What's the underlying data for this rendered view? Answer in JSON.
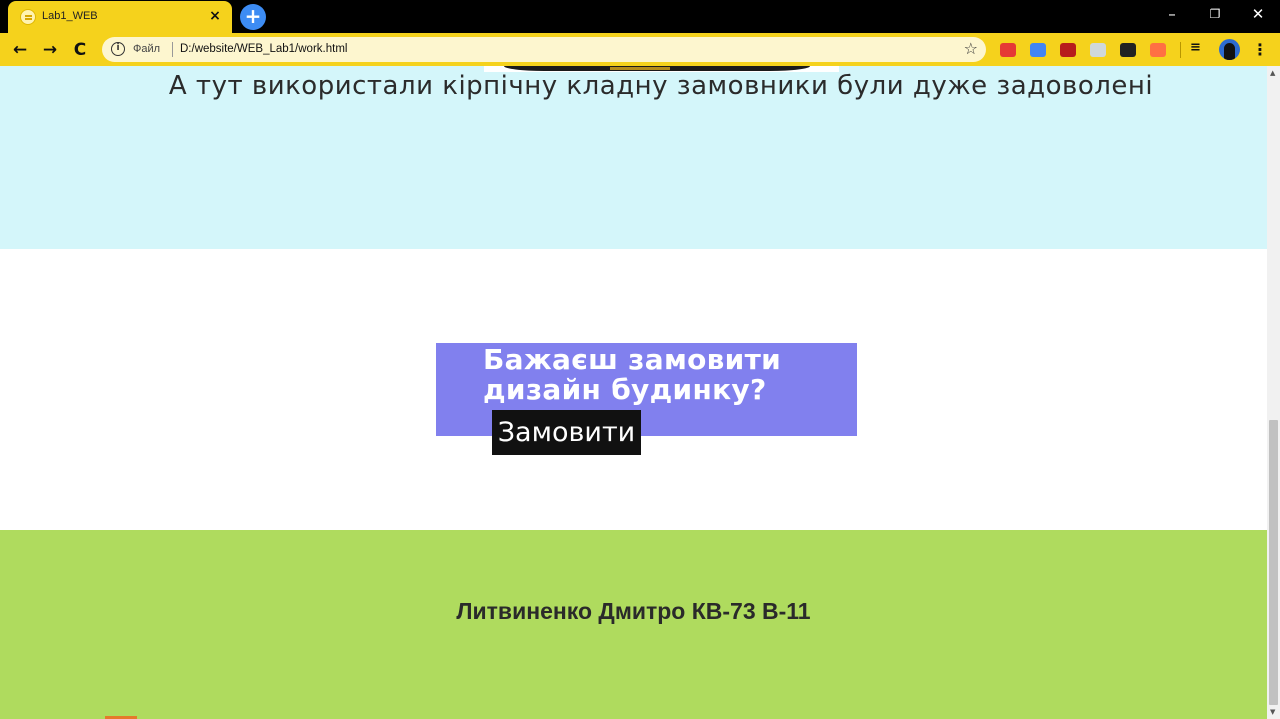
{
  "browser": {
    "tab_title": "Lab1_WEB",
    "tab_close": "×",
    "new_tab": "+",
    "scheme_label": "Файл",
    "url": "D:/website/WEB_Lab1/work.html",
    "info_glyph": "i",
    "star_glyph": "☆",
    "back_glyph": "←",
    "forward_glyph": "→",
    "reload_glyph": "C",
    "minimize_glyph": "–",
    "restore_glyph": "❐",
    "close_glyph": "✕",
    "menu_glyph": "⋮",
    "accent_color": "#f5d21c",
    "extensions": [
      {
        "name": "ext-red-icon",
        "color": "#e53935"
      },
      {
        "name": "google-translate-icon",
        "color": "#4285f4"
      },
      {
        "name": "ublock-icon",
        "color": "#b71c1c"
      },
      {
        "name": "ext-globe-icon",
        "color": "#cfd8dc"
      },
      {
        "name": "picture-in-picture-icon",
        "color": "#222222"
      },
      {
        "name": "ext-orange-icon",
        "color": "#ff7043"
      }
    ]
  },
  "page": {
    "caption": "А тут використали кірпічну кладну замовники були дуже задоволені",
    "cta_title": "Бажаєш замовити дизайн будинку?",
    "cta_button": "Замовити",
    "footer": "Литвиненко Дмитро КВ-73 В-11",
    "colors": {
      "caption_bg": "#d4f6fa",
      "cta_bg": "#8180ee",
      "button_bg": "#111111",
      "footer_bg": "#afdb5e"
    }
  }
}
